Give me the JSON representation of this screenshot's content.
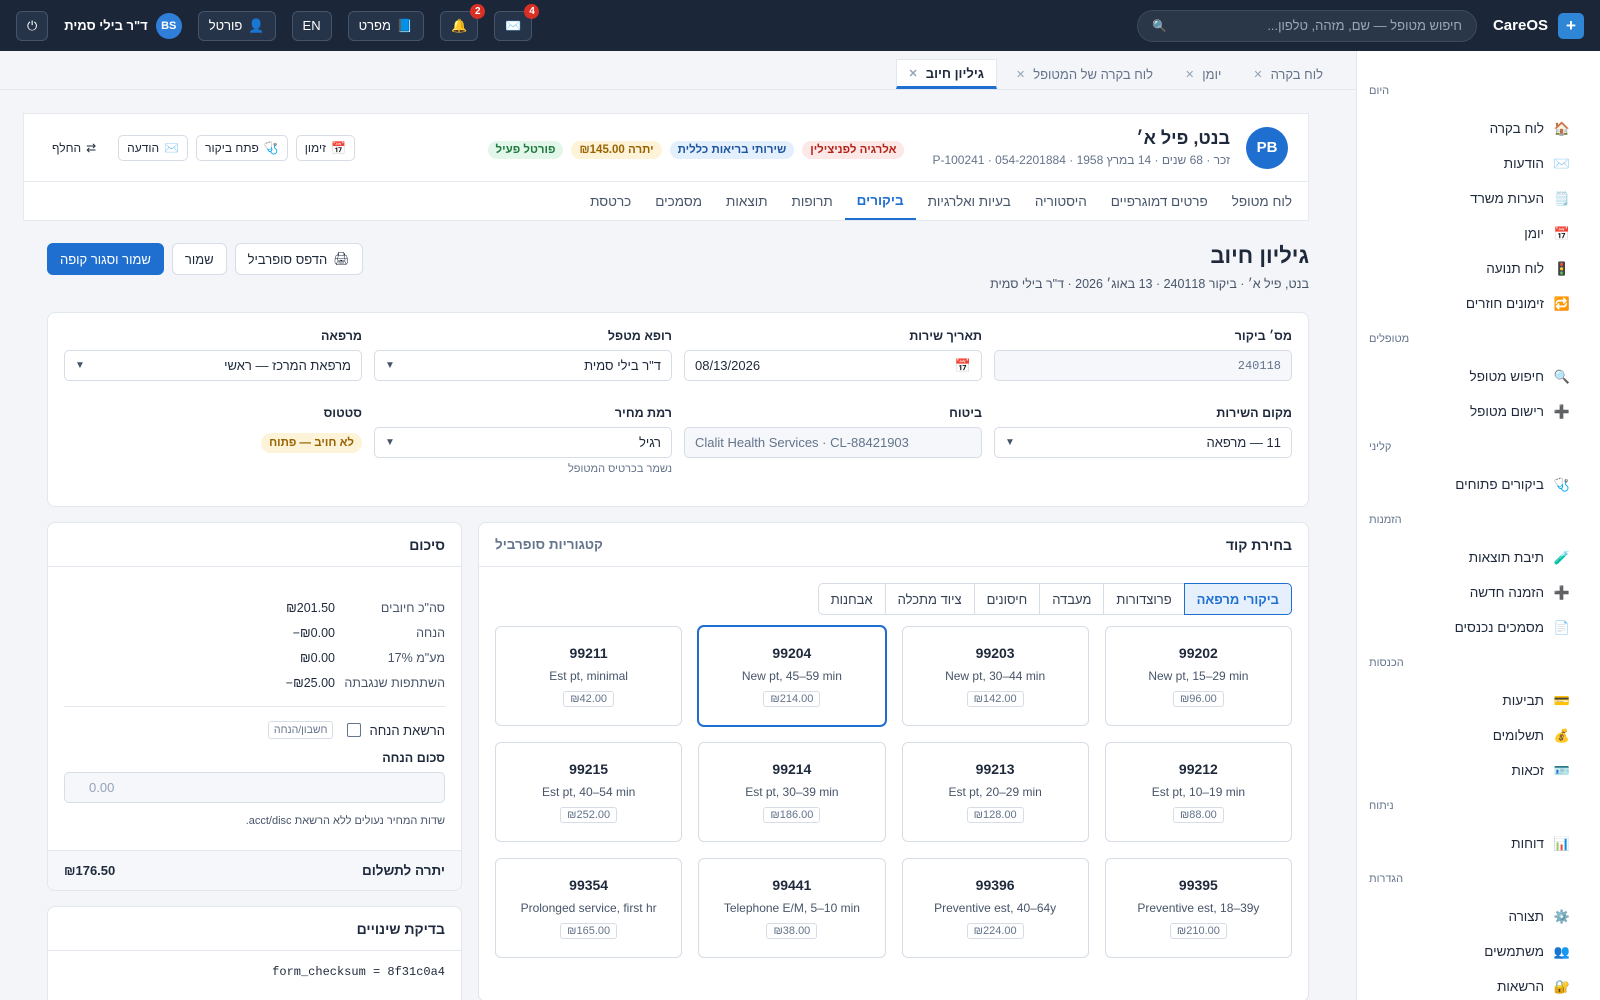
{
  "app": {
    "name": "CareOS"
  },
  "topbar": {
    "search_placeholder": "חיפוש מטופל — שם, מזהה, טלפון...",
    "mail_badge": "4",
    "bell_badge": "2",
    "manual_label": "מפרט",
    "lang_label": "EN",
    "portal_label": "פורטל",
    "user_initials": "BS",
    "user_name": "ד\"ר בילי סמית"
  },
  "sidebar": {
    "sections": [
      {
        "title": "היום",
        "items": [
          {
            "icon": "🏠",
            "label": "לוח בקרה"
          },
          {
            "icon": "✉️",
            "label": "הודעות"
          },
          {
            "icon": "🗒️",
            "label": "הערות משרד"
          },
          {
            "icon": "📅",
            "label": "יומן"
          },
          {
            "icon": "🚦",
            "label": "לוח תנועה"
          },
          {
            "icon": "🔁",
            "label": "זימונים חוזרים"
          }
        ]
      },
      {
        "title": "מטופלים",
        "items": [
          {
            "icon": "🔍",
            "label": "חיפוש מטופל"
          },
          {
            "icon": "➕",
            "label": "רישום מטופל"
          }
        ]
      },
      {
        "title": "קליני",
        "items": [
          {
            "icon": "🩺",
            "label": "ביקורים פתוחים"
          }
        ]
      },
      {
        "title": "הזמנות",
        "items": [
          {
            "icon": "🧪",
            "label": "תיבת תוצאות"
          },
          {
            "icon": "➕",
            "label": "הזמנה חדשה"
          },
          {
            "icon": "📄",
            "label": "מסמכים נכנסים"
          }
        ]
      },
      {
        "title": "הכנסות",
        "items": [
          {
            "icon": "💳",
            "label": "תביעות"
          },
          {
            "icon": "💰",
            "label": "תשלומים"
          },
          {
            "icon": "🪪",
            "label": "זכאות"
          }
        ]
      },
      {
        "title": "ניתוח",
        "items": [
          {
            "icon": "📊",
            "label": "דוחות"
          }
        ]
      },
      {
        "title": "הגדרות",
        "items": [
          {
            "icon": "⚙️",
            "label": "תצורה"
          },
          {
            "icon": "👥",
            "label": "משתמשים"
          },
          {
            "icon": "🔐",
            "label": "הרשאות"
          }
        ]
      }
    ]
  },
  "tabs": [
    {
      "label": "לוח בקרה",
      "active": false
    },
    {
      "label": "יומן",
      "active": false
    },
    {
      "label": "לוח בקרה של המטופל",
      "active": false
    },
    {
      "label": "גיליון חיוב",
      "active": true
    }
  ],
  "patient": {
    "initials": "PB",
    "name": "בנט, פיל א׳",
    "meta": "זכר · 68 שנים · 14 במרץ 1958 · P-100241 · 054-2201884",
    "pills": [
      {
        "label": "אלרגיה לפניצילין",
        "tone": "red"
      },
      {
        "label": "שירותי בריאות כללית",
        "tone": "blue"
      },
      {
        "label": "יתרה ₪145.00",
        "tone": "amber"
      },
      {
        "label": "פורטל פעיל",
        "tone": "green"
      }
    ],
    "actions": {
      "schedule": "זימון",
      "open_visit": "פתח ביקור",
      "message": "הודעה",
      "switch": "החלף"
    }
  },
  "subtabs": [
    {
      "label": "לוח מטופל",
      "active": false
    },
    {
      "label": "פרטים דמוגרפיים",
      "active": false
    },
    {
      "label": "היסטוריה",
      "active": false
    },
    {
      "label": "בעיות ואלרגיות",
      "active": false
    },
    {
      "label": "ביקורים",
      "active": true
    },
    {
      "label": "תרופות",
      "active": false
    },
    {
      "label": "תוצאות",
      "active": false
    },
    {
      "label": "מסמכים",
      "active": false
    },
    {
      "label": "כרטסת",
      "active": false
    }
  ],
  "page": {
    "title": "גיליון חיוב",
    "subtitle": "בנט, פיל א׳ · ביקור 240118 · 13 באוג׳ 2026 · ד\"ר בילי סמית",
    "print_label": "הדפס סופרביל",
    "save_label": "שמור",
    "save_close_label": "שמור וסגור קופה"
  },
  "form": {
    "visit_no": {
      "label": "מס׳ ביקור",
      "value": "240118"
    },
    "service_date": {
      "label": "תאריך שירות",
      "value": "08/13/2026"
    },
    "provider": {
      "label": "רופא מטפל",
      "value": "ד\"ר בילי סמית"
    },
    "clinic": {
      "label": "מרפאה",
      "value": "מרפאת המרכז — ראשי"
    },
    "place": {
      "label": "מקום השירות",
      "value": "11 — מרפאה"
    },
    "insurance": {
      "label": "ביטוח",
      "value": "Clalit Health Services · CL-88421903"
    },
    "price_level": {
      "label": "רמת מחיר",
      "value": "רגיל",
      "hint": "נשמר בכרטיס המטופל"
    },
    "status": {
      "label": "סטטוס",
      "value": "לא חויב — פתוח"
    }
  },
  "codes": {
    "title": "בחירת קוד",
    "subtitle": "קטגוריות סופרביל",
    "categories": [
      {
        "label": "ביקורי מרפאה",
        "active": true
      },
      {
        "label": "פרוצדורות",
        "active": false
      },
      {
        "label": "מעבדה",
        "active": false
      },
      {
        "label": "חיסונים",
        "active": false
      },
      {
        "label": "ציוד מתכלה",
        "active": false
      },
      {
        "label": "אבחנות",
        "active": false
      }
    ],
    "items": [
      {
        "code": "99202",
        "desc": "New pt, 15–29 min",
        "price": "₪96.00",
        "selected": false
      },
      {
        "code": "99203",
        "desc": "New pt, 30–44 min",
        "price": "₪142.00",
        "selected": false
      },
      {
        "code": "99204",
        "desc": "New pt, 45–59 min",
        "price": "₪214.00",
        "selected": true
      },
      {
        "code": "99211",
        "desc": "Est pt, minimal",
        "price": "₪42.00",
        "selected": false
      },
      {
        "code": "99212",
        "desc": "Est pt, 10–19 min",
        "price": "₪88.00",
        "selected": false
      },
      {
        "code": "99213",
        "desc": "Est pt, 20–29 min",
        "price": "₪128.00",
        "selected": false
      },
      {
        "code": "99214",
        "desc": "Est pt, 30–39 min",
        "price": "₪186.00",
        "selected": false
      },
      {
        "code": "99215",
        "desc": "Est pt, 40–54 min",
        "price": "₪252.00",
        "selected": false
      },
      {
        "code": "99395",
        "desc": "Preventive est, 18–39y",
        "price": "₪210.00",
        "selected": false
      },
      {
        "code": "99396",
        "desc": "Preventive est, 40–64y",
        "price": "₪224.00",
        "selected": false
      },
      {
        "code": "99441",
        "desc": "Telephone E/M, 5–10 min",
        "price": "₪38.00",
        "selected": false
      },
      {
        "code": "99354",
        "desc": "Prolonged service, first hr",
        "price": "₪165.00",
        "selected": false
      }
    ]
  },
  "summary": {
    "title": "סיכום",
    "rows": [
      {
        "label": "סה\"כ חיובים",
        "value": "₪201.50"
      },
      {
        "label": "הנחה",
        "value": "−₪0.00"
      },
      {
        "label": "מע\"מ 17%",
        "value": "₪0.00"
      },
      {
        "label": "השתתפות שנגבתה",
        "value": "−₪25.00"
      }
    ],
    "discount_perm_label": "הרשאת הנחה",
    "discount_perm_tag": "חשבון/הנחה",
    "discount_amount_label": "סכום הנחה",
    "discount_amount_placeholder": "0.00",
    "discount_note": "שדות המחיר נעולים ללא הרשאת acct/disc.",
    "balance_label": "יתרה לתשלום",
    "balance_value": "₪176.50"
  },
  "diff": {
    "title": "בדיקת שינויים",
    "checksum": "form_checksum = 8f31c0a4"
  }
}
